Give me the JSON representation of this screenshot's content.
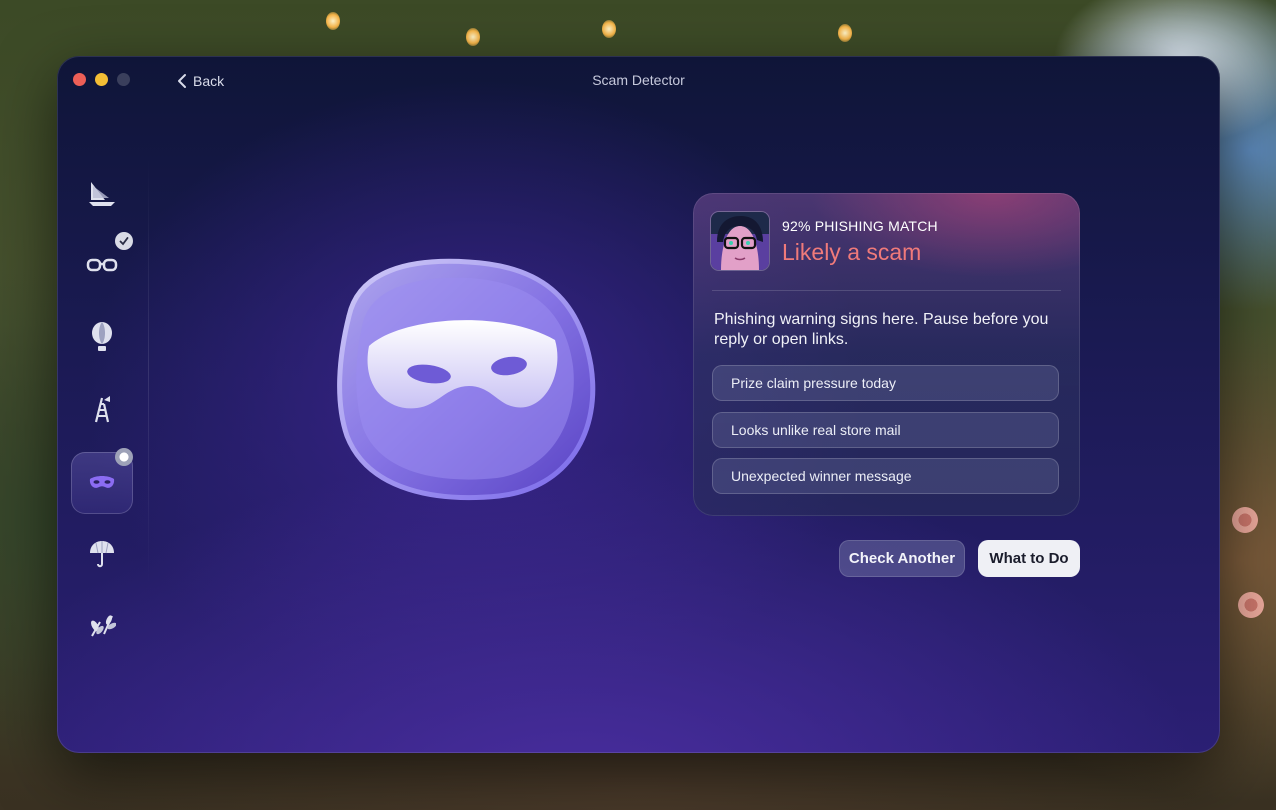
{
  "window": {
    "title": "Scam Detector",
    "back_label": "Back"
  },
  "sidebar": {
    "items": [
      {
        "icon": "sailboat-icon",
        "state": "default"
      },
      {
        "icon": "glasses-icon",
        "state": "checked"
      },
      {
        "icon": "balloon-icon",
        "state": "default"
      },
      {
        "icon": "ladder-icon",
        "state": "default"
      },
      {
        "icon": "mask-icon",
        "state": "active"
      },
      {
        "icon": "umbrella-icon",
        "state": "default"
      },
      {
        "icon": "leaves-icon",
        "state": "default"
      }
    ]
  },
  "result": {
    "match_label": "92% PHISHING MATCH",
    "verdict": "Likely a scam",
    "description": "Phishing warning signs here. Pause before you reply or open links.",
    "signs": [
      "Prize claim pressure today",
      "Looks unlike real store mail",
      "Unexpected winner message"
    ]
  },
  "actions": {
    "check_another": "Check Another",
    "what_to_do": "What to Do"
  },
  "colors": {
    "verdict": "#f07a7a",
    "accent": "#7b6cf0",
    "close": "#ed5f57",
    "minimize": "#f4be35"
  }
}
